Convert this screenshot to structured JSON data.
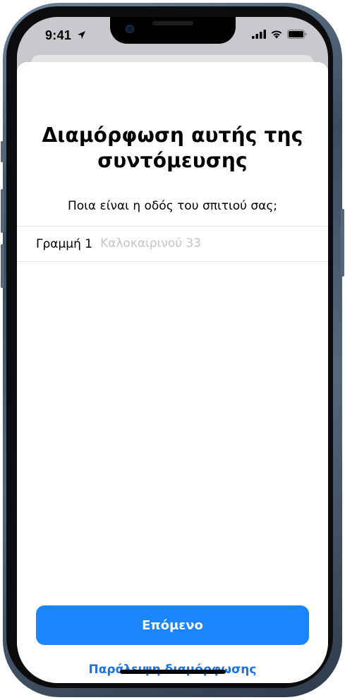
{
  "status_bar": {
    "time": "9:41",
    "location_icon": "location-arrow-icon",
    "signal_icon": "cellular-signal-icon",
    "wifi_icon": "wifi-icon",
    "battery_icon": "battery-icon"
  },
  "sheet": {
    "title_line1": "Διαμόρφωση αυτής της",
    "title_line2": "συντόμευσης",
    "prompt": "Ποια είναι η οδός του σπιτιού σας;",
    "field": {
      "label": "Γραμμή 1",
      "value": "",
      "placeholder": "Καλοκαιρινού 33"
    },
    "next_button": "Επόμενο",
    "skip_link": "Παράλειψη διαμόρφωσης"
  },
  "colors": {
    "accent": "#1b84ff",
    "link": "#1a73e8",
    "placeholder": "#c4c4c9"
  }
}
